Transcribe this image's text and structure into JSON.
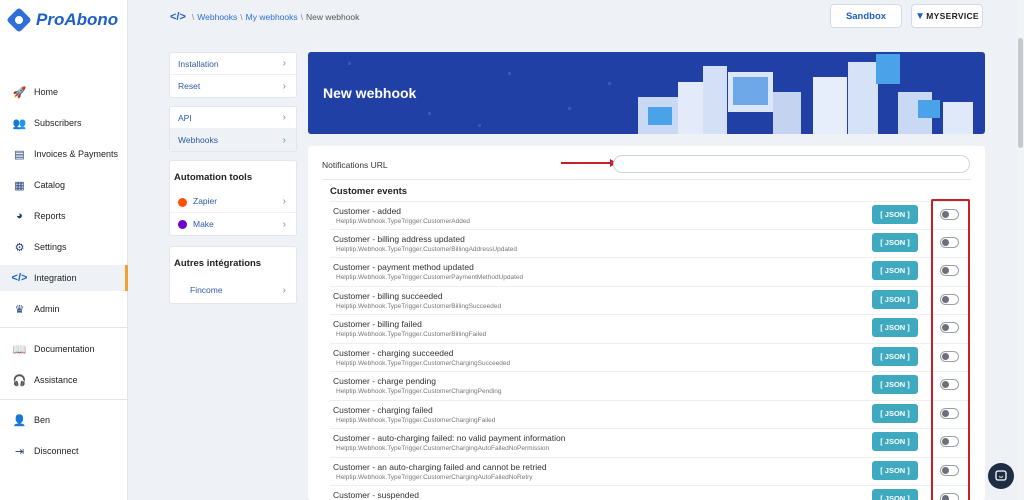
{
  "app": {
    "logo_text": "ProAbono"
  },
  "nav": {
    "items": [
      {
        "label": "Home",
        "icon": "rocket-icon"
      },
      {
        "label": "Subscribers",
        "icon": "users-icon"
      },
      {
        "label": "Invoices & Payments",
        "icon": "invoice-icon"
      },
      {
        "label": "Catalog",
        "icon": "catalog-icon"
      },
      {
        "label": "Reports",
        "icon": "pie-chart-icon"
      },
      {
        "label": "Settings",
        "icon": "gear-icon"
      },
      {
        "label": "Integration",
        "icon": "code-icon"
      },
      {
        "label": "Admin",
        "icon": "crown-icon"
      }
    ],
    "bottom_items": [
      {
        "label": "Documentation",
        "icon": "book-icon"
      },
      {
        "label": "Assistance",
        "icon": "headset-icon"
      }
    ],
    "user_items": [
      {
        "label": "Ben",
        "icon": "user-icon"
      },
      {
        "label": "Disconnect",
        "icon": "logout-icon"
      }
    ]
  },
  "breadcrumb": {
    "sep": "\\",
    "webhooks": "Webhooks",
    "my_webhooks": "My webhooks",
    "current": "New webhook"
  },
  "header": {
    "sandbox_label": "Sandbox",
    "service_label": "MYSERVICE"
  },
  "side": {
    "setup": [
      "Installation",
      "Reset"
    ],
    "api": [
      "API",
      "Webhooks"
    ],
    "automation_title": "Automation tools",
    "automation": [
      "Zapier",
      "Make"
    ],
    "other_title": "Autres intégrations",
    "other": [
      "Fincome"
    ]
  },
  "banner": {
    "title": "New webhook"
  },
  "form": {
    "url_label": "Notifications URL",
    "url_value": "",
    "section_title": "Customer events",
    "json_label": "[ JSON ]"
  },
  "events": [
    {
      "name": "Customer - added",
      "help": "Helptip.Webhook.TypeTrigger.CustomerAdded"
    },
    {
      "name": "Customer - billing address updated",
      "help": "Helptip.Webhook.TypeTrigger.CustomerBillingAddressUpdated"
    },
    {
      "name": "Customer - payment method updated",
      "help": "Helptip.Webhook.TypeTrigger.CustomerPaymentMethodUpdated"
    },
    {
      "name": "Customer - billing succeeded",
      "help": "Helptip.Webhook.TypeTrigger.CustomerBillingSucceeded"
    },
    {
      "name": "Customer - billing failed",
      "help": "Helptip.Webhook.TypeTrigger.CustomerBillingFailed"
    },
    {
      "name": "Customer - charging succeeded",
      "help": "Helptip.Webhook.TypeTrigger.CustomerChargingSucceeded"
    },
    {
      "name": "Customer - charge pending",
      "help": "Helptip.Webhook.TypeTrigger.CustomerChargingPending"
    },
    {
      "name": "Customer - charging failed",
      "help": "Helptip.Webhook.TypeTrigger.CustomerChargingFailed"
    },
    {
      "name": "Customer - auto-charging failed: no valid payment information",
      "help": "Helptip.Webhook.TypeTrigger.CustomerChargingAutoFailedNoPermission"
    },
    {
      "name": "Customer - an auto-charging failed and cannot be retried",
      "help": "Helptip.Webhook.TypeTrigger.CustomerChargingAutoFailedNoRetry"
    },
    {
      "name": "Customer - suspended",
      "help": ""
    }
  ],
  "colors": {
    "accent": "#1e5fc9",
    "banner": "#2140a6",
    "json_button": "#3fa9c0",
    "highlight": "#c8202a",
    "active_marker": "#f0a030"
  }
}
